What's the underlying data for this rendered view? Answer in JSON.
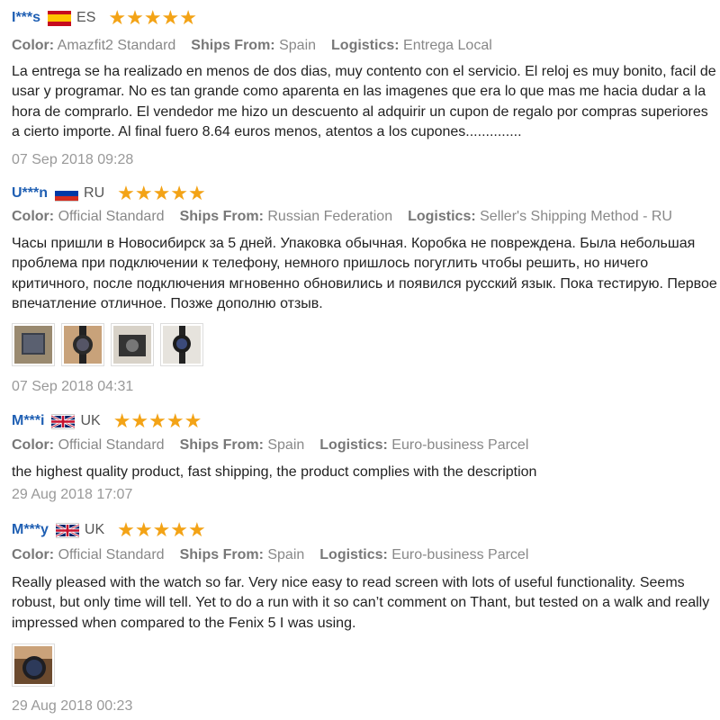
{
  "labels": {
    "color": "Color:",
    "ships_from": "Ships From:",
    "logistics": "Logistics:"
  },
  "reviews": [
    {
      "name": "I***s",
      "country": "ES",
      "flag_icon": "spain-flag-icon",
      "stars": "★★★★★",
      "color": "Amazfit2 Standard",
      "ships_from": "Spain",
      "logistics": "Entrega Local",
      "text": "La entrega se ha realizado en menos de dos dias, muy contento con el servicio. El reloj es muy bonito, facil de usar y programar.  No es tan grande como aparenta en las imagenes que era lo que mas me hacia dudar a la hora de comprarlo. El vendedor me hizo un descuento al adquirir un cupon de regalo por compras superiores a cierto importe.  Al final fuero 8.64 euros menos, atentos a los cupones..............",
      "date": "07 Sep 2018 09:28"
    },
    {
      "name": "U***n",
      "country": "RU",
      "flag_icon": "russia-flag-icon",
      "stars": "★★★★★",
      "color": "Official Standard",
      "ships_from": "Russian Federation",
      "logistics": "Seller's Shipping Method - RU",
      "text": "Часы пришли в Новосибирск за 5 дней. Упаковка обычная. Коробка не повреждена. Была небольшая проблема при подключении к телефону, немного пришлось погуглить чтобы решить, но ничего критичного,  после подключения мгновенно обновились и появился русский язык. Пока тестирую. Первое впечатление отличное. Позже дополню отзыв.",
      "date": "07 Sep 2018 04:31"
    },
    {
      "name": "M***i",
      "country": "UK",
      "flag_icon": "uk-flag-icon",
      "stars": "★★★★★",
      "color": "Official Standard",
      "ships_from": "Spain",
      "logistics": "Euro-business Parcel",
      "text": "the highest quality product, fast shipping, the product complies with the description",
      "date": "29 Aug 2018 17:07"
    },
    {
      "name": "M***y",
      "country": "UK",
      "flag_icon": "uk-flag-icon",
      "stars": "★★★★★",
      "color": "Official Standard",
      "ships_from": "Spain",
      "logistics": "Euro-business Parcel",
      "text": "Really pleased with the watch so far. Very nice easy to read screen with lots of useful functionality. Seems robust, but only time will tell. Yet to do a run with it so can’t comment on Thant, but tested on a walk and really impressed when compared to the Fenix 5 I was using.",
      "date": "29 Aug 2018 00:23"
    }
  ]
}
